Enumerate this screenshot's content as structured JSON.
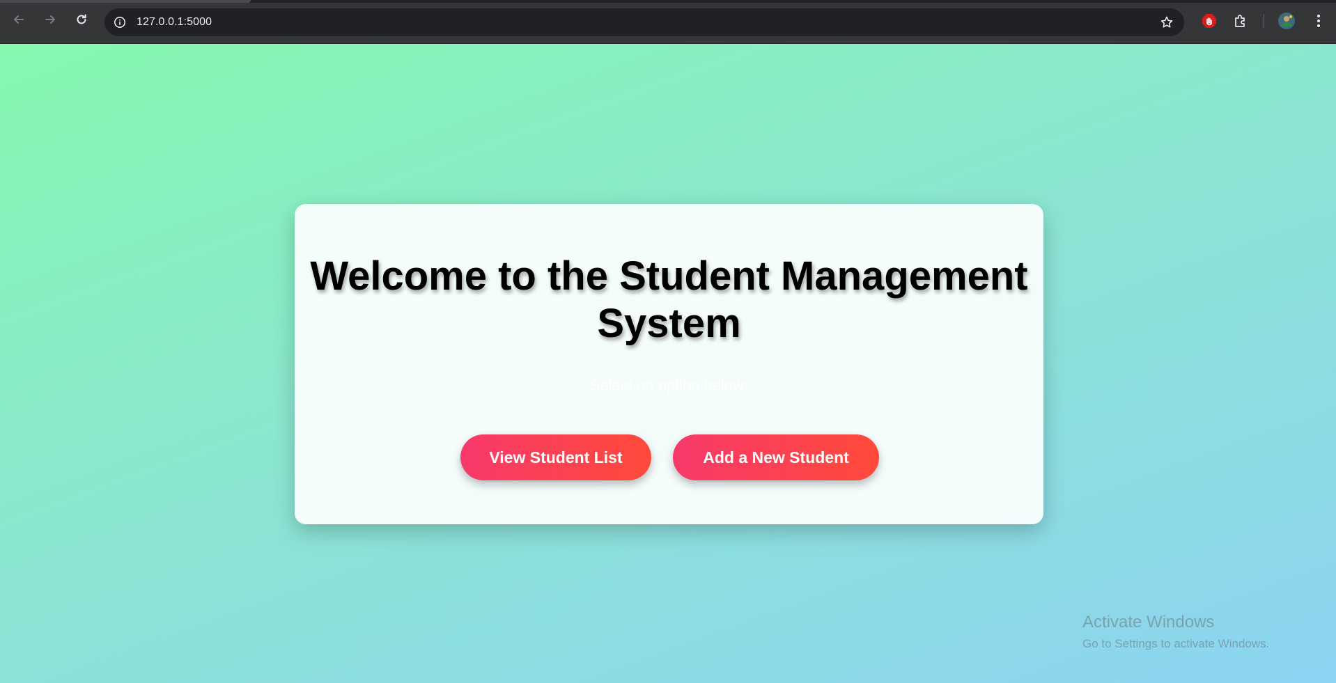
{
  "browser": {
    "url": "127.0.0.1:5000",
    "icons": {
      "back": "back-arrow-icon",
      "forward": "forward-arrow-icon",
      "reload": "reload-icon",
      "info": "info-icon",
      "bookmark": "star-icon",
      "extension_blocker": "stop-hand-icon",
      "extensions": "puzzle-icon",
      "profile": "avatar",
      "menu": "kebab-menu-icon"
    }
  },
  "page": {
    "title": "Welcome to the Student Management System",
    "subtitle": "Select an option below:",
    "buttons": {
      "view_students": "View Student List",
      "add_student": "Add a New Student"
    },
    "colors": {
      "button_gradient_start": "#f8396b",
      "button_gradient_end": "#ff4a3a",
      "background_start": "#86f7b0",
      "background_end": "#8cd3f2"
    }
  },
  "os_watermark": {
    "title": "Activate Windows",
    "subtitle": "Go to Settings to activate Windows."
  }
}
